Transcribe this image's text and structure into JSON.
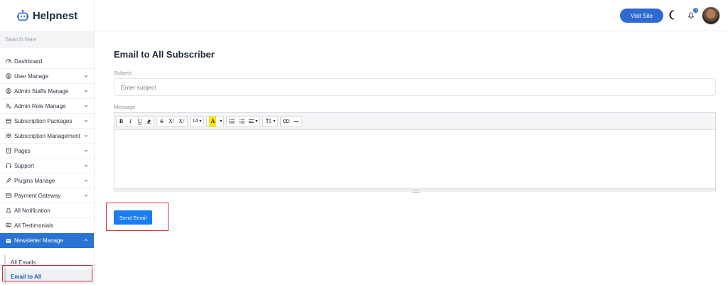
{
  "brand": {
    "name": "Helpnest"
  },
  "search": {
    "placeholder": "Search here"
  },
  "sidebar": {
    "items": [
      {
        "label": "Dashboard",
        "icon": "dashboard-icon",
        "has_chevron": false
      },
      {
        "label": "User Manage",
        "icon": "user-circle-icon",
        "has_chevron": true
      },
      {
        "label": "Admin Staffs Manage",
        "icon": "user-circle-icon",
        "has_chevron": true
      },
      {
        "label": "Admin Role Manage",
        "icon": "user-role-icon",
        "has_chevron": true
      },
      {
        "label": "Subscription Packages",
        "icon": "package-icon",
        "has_chevron": true
      },
      {
        "label": "Subscription Management",
        "icon": "users-icon",
        "has_chevron": true
      },
      {
        "label": "Pages",
        "icon": "page-icon",
        "has_chevron": true
      },
      {
        "label": "Support",
        "icon": "headset-icon",
        "has_chevron": true
      },
      {
        "label": "Plugins Manage",
        "icon": "plug-icon",
        "has_chevron": true
      },
      {
        "label": "Payment Gateway",
        "icon": "card-icon",
        "has_chevron": true
      },
      {
        "label": "All Notification",
        "icon": "bell-icon",
        "has_chevron": false
      },
      {
        "label": "All Testimonials",
        "icon": "chat-icon",
        "has_chevron": false
      },
      {
        "label": "Newsletter Manage",
        "icon": "newsletter-icon",
        "has_chevron": true,
        "active": true
      }
    ],
    "sub_items": [
      {
        "label": "All Emails"
      },
      {
        "label": "Email to All",
        "active": true
      }
    ]
  },
  "topbar": {
    "visit_site": "Visit Site",
    "notification_count": "0"
  },
  "main": {
    "title": "Email to All Subscriber",
    "subject_label": "Subject",
    "subject_placeholder": "Enter subject",
    "message_label": "Message",
    "font_size": "14",
    "send_button": "Send Email"
  },
  "colors": {
    "primary": "#2f6ad0",
    "send_button": "#1a7cf0",
    "sidebar_active": "#2a73d2",
    "highlight_box": "#d52d3a"
  }
}
